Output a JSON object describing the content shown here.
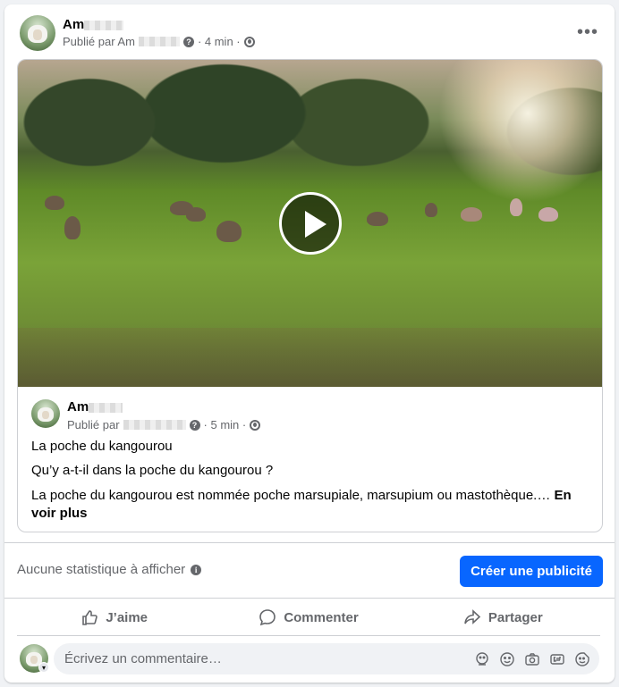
{
  "post": {
    "author_name": "Am",
    "published_by_prefix": "Publié par Am",
    "time": "· 4 min ·",
    "more_icon": "more-horizontal-icon"
  },
  "shared_post": {
    "author_name": "Am",
    "published_by_prefix": "Publié par",
    "time": "· 5 min ·",
    "video_play_icon": "play-icon",
    "title": "La poche du kangourou",
    "question": "Qu’y a-t-il dans la poche du kangourou ?",
    "body": "La poche du kangourou est nommée poche marsupiale, marsupium ou mastothèque.… ",
    "see_more_1": "En",
    "see_more_2": "voir plus"
  },
  "insights": {
    "no_stats": "Aucune statistique à afficher",
    "create_ad": "Créer une publicité"
  },
  "actions": {
    "like": "J’aime",
    "comment": "Commenter",
    "share": "Partager"
  },
  "comment": {
    "placeholder": "Écrivez un commentaire…"
  },
  "colors": {
    "accent": "#0866ff",
    "secondary_text": "#65676b"
  }
}
